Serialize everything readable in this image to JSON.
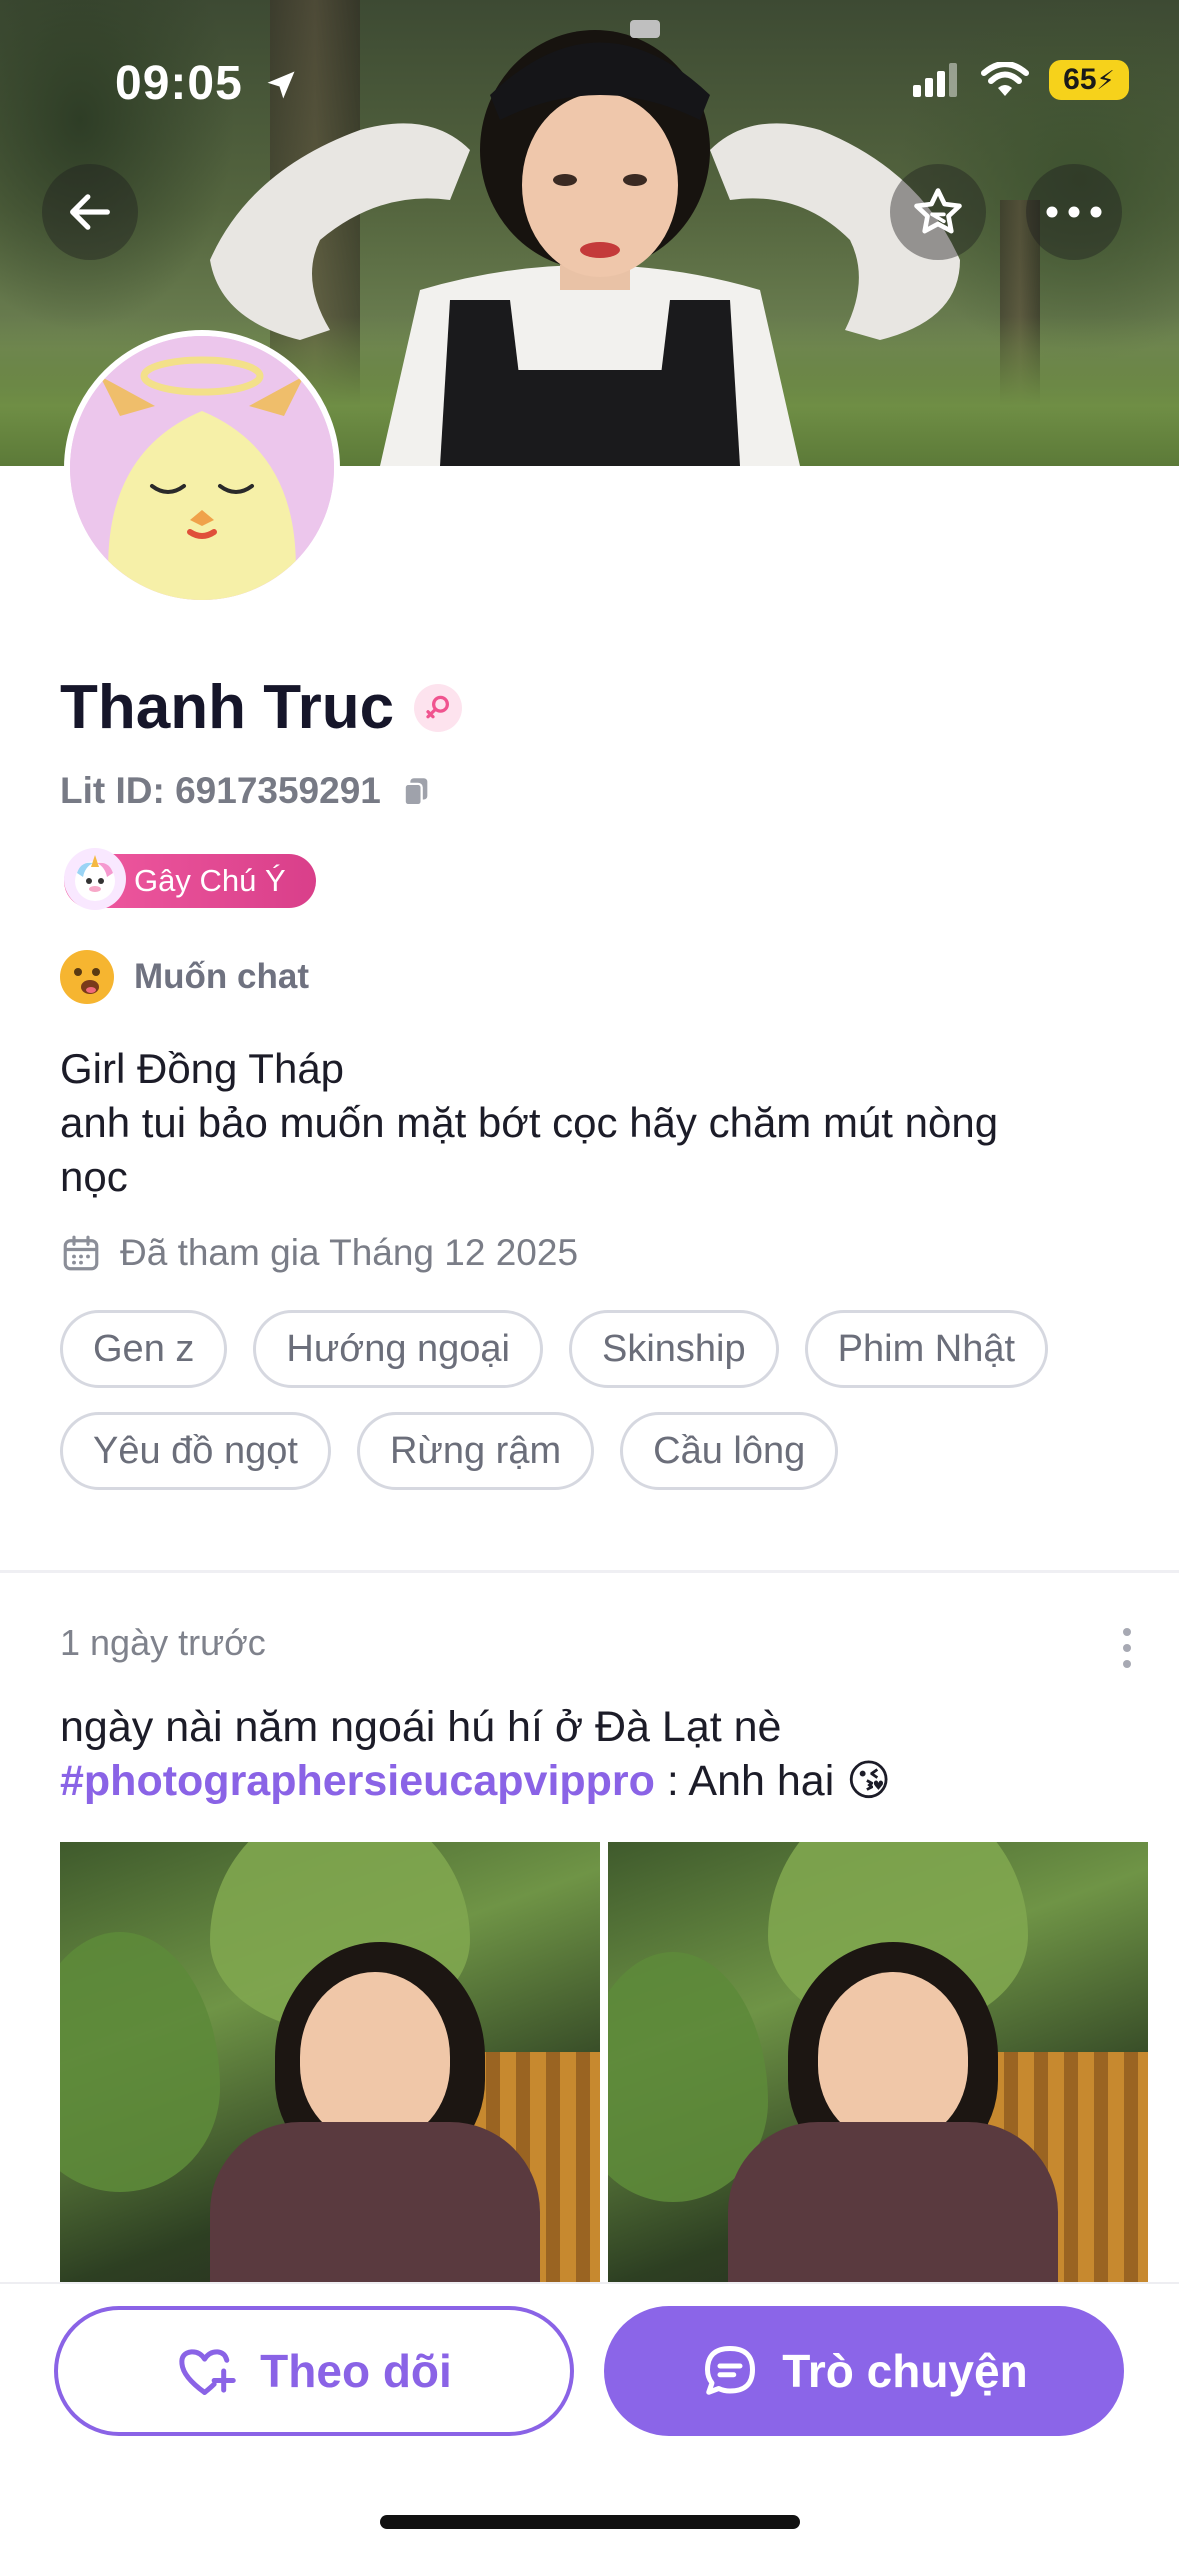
{
  "status_bar": {
    "time": "09:05",
    "battery": "65"
  },
  "profile": {
    "name": "Thanh Truc",
    "lit_id": "Lit ID: 6917359291",
    "badge": "Gây Chú Ý",
    "mood": "Muốn chat",
    "bio_lines": [
      "Girl Đồng Tháp",
      "anh tui bảo muốn mặt bớt cọc hãy chăm mút nòng",
      "nọc"
    ],
    "joined": "Đã tham gia Tháng 12 2025",
    "tags": [
      "Gen z",
      "Hướng ngoại",
      "Skinship",
      "Phim Nhật",
      "Yêu đồ ngọt",
      "Rừng rậm",
      "Cầu lông"
    ]
  },
  "post": {
    "time": "1 ngày trước",
    "text_line1": "ngày nài năm ngoái hú hí ở Đà Lạt nè",
    "hashtag": "#photographersieucapvippro",
    "text_tail": " : Anh hai 😘"
  },
  "actions": {
    "follow_label": "Theo dõi",
    "chat_label": "Trò chuyện"
  },
  "colors": {
    "accent": "#8b65e8",
    "badge_pink": "#e04a93",
    "battery_yellow": "#f6d21b"
  },
  "icons": {
    "back": "arrow-left-icon",
    "favorite": "star-outline-icon",
    "more": "more-horizontal-icon",
    "gender": "female-gender-icon",
    "copy": "copy-icon",
    "calendar": "calendar-icon",
    "follow": "heart-plus-icon",
    "chat": "chat-bubble-icon"
  }
}
